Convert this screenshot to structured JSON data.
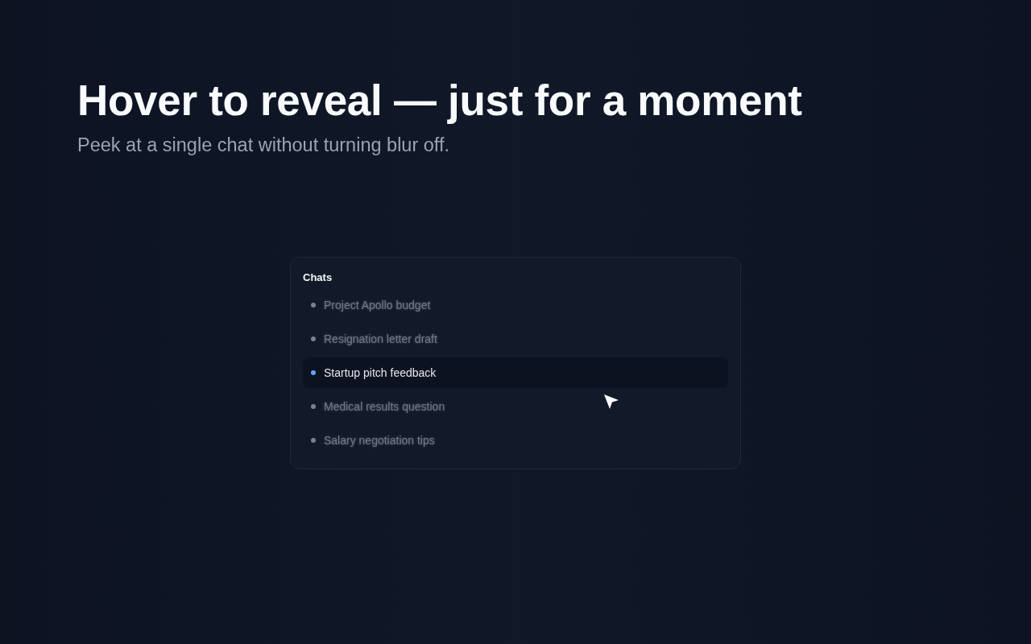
{
  "hero": {
    "title": "Hover to reveal — just for a moment",
    "subtitle": "Peek at a single chat without turning blur off."
  },
  "chats_panel": {
    "title": "Chats",
    "items": [
      {
        "label": "Project Apollo budget",
        "selected": false,
        "blurred": true
      },
      {
        "label": "Resignation letter draft",
        "selected": false,
        "blurred": true
      },
      {
        "label": "Startup pitch feedback",
        "selected": true,
        "blurred": false
      },
      {
        "label": "Medical results question",
        "selected": false,
        "blurred": true
      },
      {
        "label": "Salary negotiation tips",
        "selected": false,
        "blurred": true
      }
    ]
  }
}
